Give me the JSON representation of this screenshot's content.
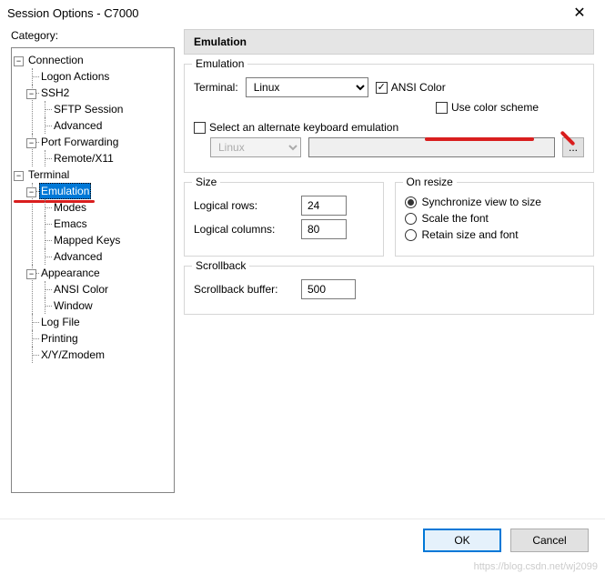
{
  "window": {
    "title": "Session Options - C7000",
    "close": "✕"
  },
  "category_label": "Category:",
  "tree": {
    "connection": {
      "label": "Connection",
      "logon": "Logon Actions",
      "ssh2": {
        "label": "SSH2",
        "sftp": "SFTP Session",
        "advanced": "Advanced"
      },
      "portfwd": {
        "label": "Port Forwarding",
        "remote": "Remote/X11"
      }
    },
    "terminal": {
      "label": "Terminal",
      "emulation": {
        "label": "Emulation",
        "modes": "Modes",
        "emacs": "Emacs",
        "mapped": "Mapped Keys",
        "advanced": "Advanced"
      },
      "appearance": {
        "label": "Appearance",
        "ansi": "ANSI Color",
        "window": "Window"
      },
      "logfile": "Log File",
      "printing": "Printing",
      "xyz": "X/Y/Zmodem"
    }
  },
  "panel": {
    "header": "Emulation",
    "group_emulation": {
      "legend": "Emulation",
      "terminal_label": "Terminal:",
      "terminal_value": "Linux",
      "ansi_color": "ANSI Color",
      "use_scheme": "Use color scheme",
      "alt_keyboard": "Select an alternate keyboard emulation",
      "alt_select_value": "Linux",
      "browse": "..."
    },
    "group_size": {
      "legend": "Size",
      "rows_label": "Logical rows:",
      "rows_value": "24",
      "cols_label": "Logical columns:",
      "cols_value": "80"
    },
    "group_resize": {
      "legend": "On resize",
      "opt1": "Synchronize view to size",
      "opt2": "Scale the font",
      "opt3": "Retain size and font"
    },
    "group_scrollback": {
      "legend": "Scrollback",
      "buffer_label": "Scrollback buffer:",
      "buffer_value": "500"
    }
  },
  "buttons": {
    "ok": "OK",
    "cancel": "Cancel"
  },
  "watermark": "https://blog.csdn.net/wj2099"
}
